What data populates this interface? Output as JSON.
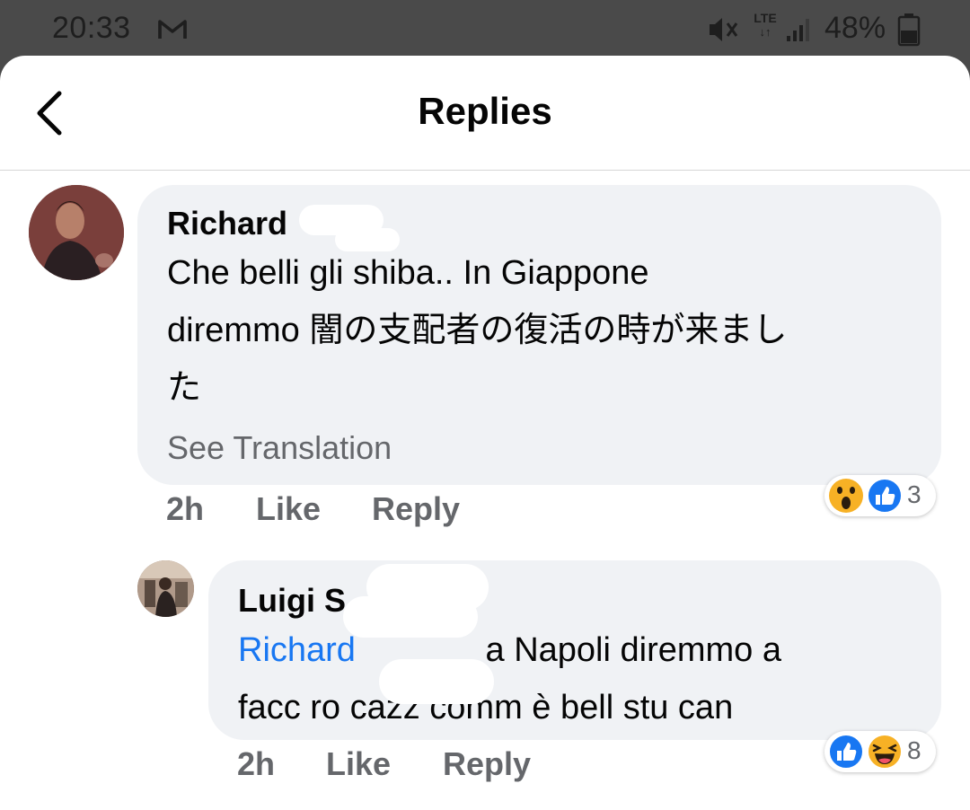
{
  "status_bar": {
    "time": "20:33",
    "network": "LTE",
    "battery": "48%",
    "icons": [
      "gmail-icon",
      "mute-icon",
      "lte-icon",
      "signal-icon",
      "battery-icon"
    ]
  },
  "header": {
    "title": "Replies",
    "back_icon": "chevron-left-icon"
  },
  "comments": [
    {
      "author": "Richard",
      "text_line1": "Che belli gli shiba.. In Giappone",
      "text_line2": "diremmo 闇の支配者の復活の時が来まし",
      "text_line3": "た",
      "see_translation": "See Translation",
      "time": "2h",
      "like_label": "Like",
      "reply_label": "Reply",
      "reactions": [
        "wow",
        "like"
      ],
      "reaction_count": "3"
    },
    {
      "author": "Luigi S",
      "mention": "Richard",
      "text_line1": " a Napoli diremmo a",
      "text_line2": "facc ro cazz comm è bell stu can",
      "time": "2h",
      "like_label": "Like",
      "reply_label": "Reply",
      "reactions": [
        "like",
        "haha"
      ],
      "reaction_count": "8"
    }
  ],
  "colors": {
    "bubble": "#f0f2f5",
    "mention": "#1877f2",
    "secondary_text": "#65676b",
    "like_blue": "#1877f2",
    "emoji_yellow": "#f7b125"
  }
}
